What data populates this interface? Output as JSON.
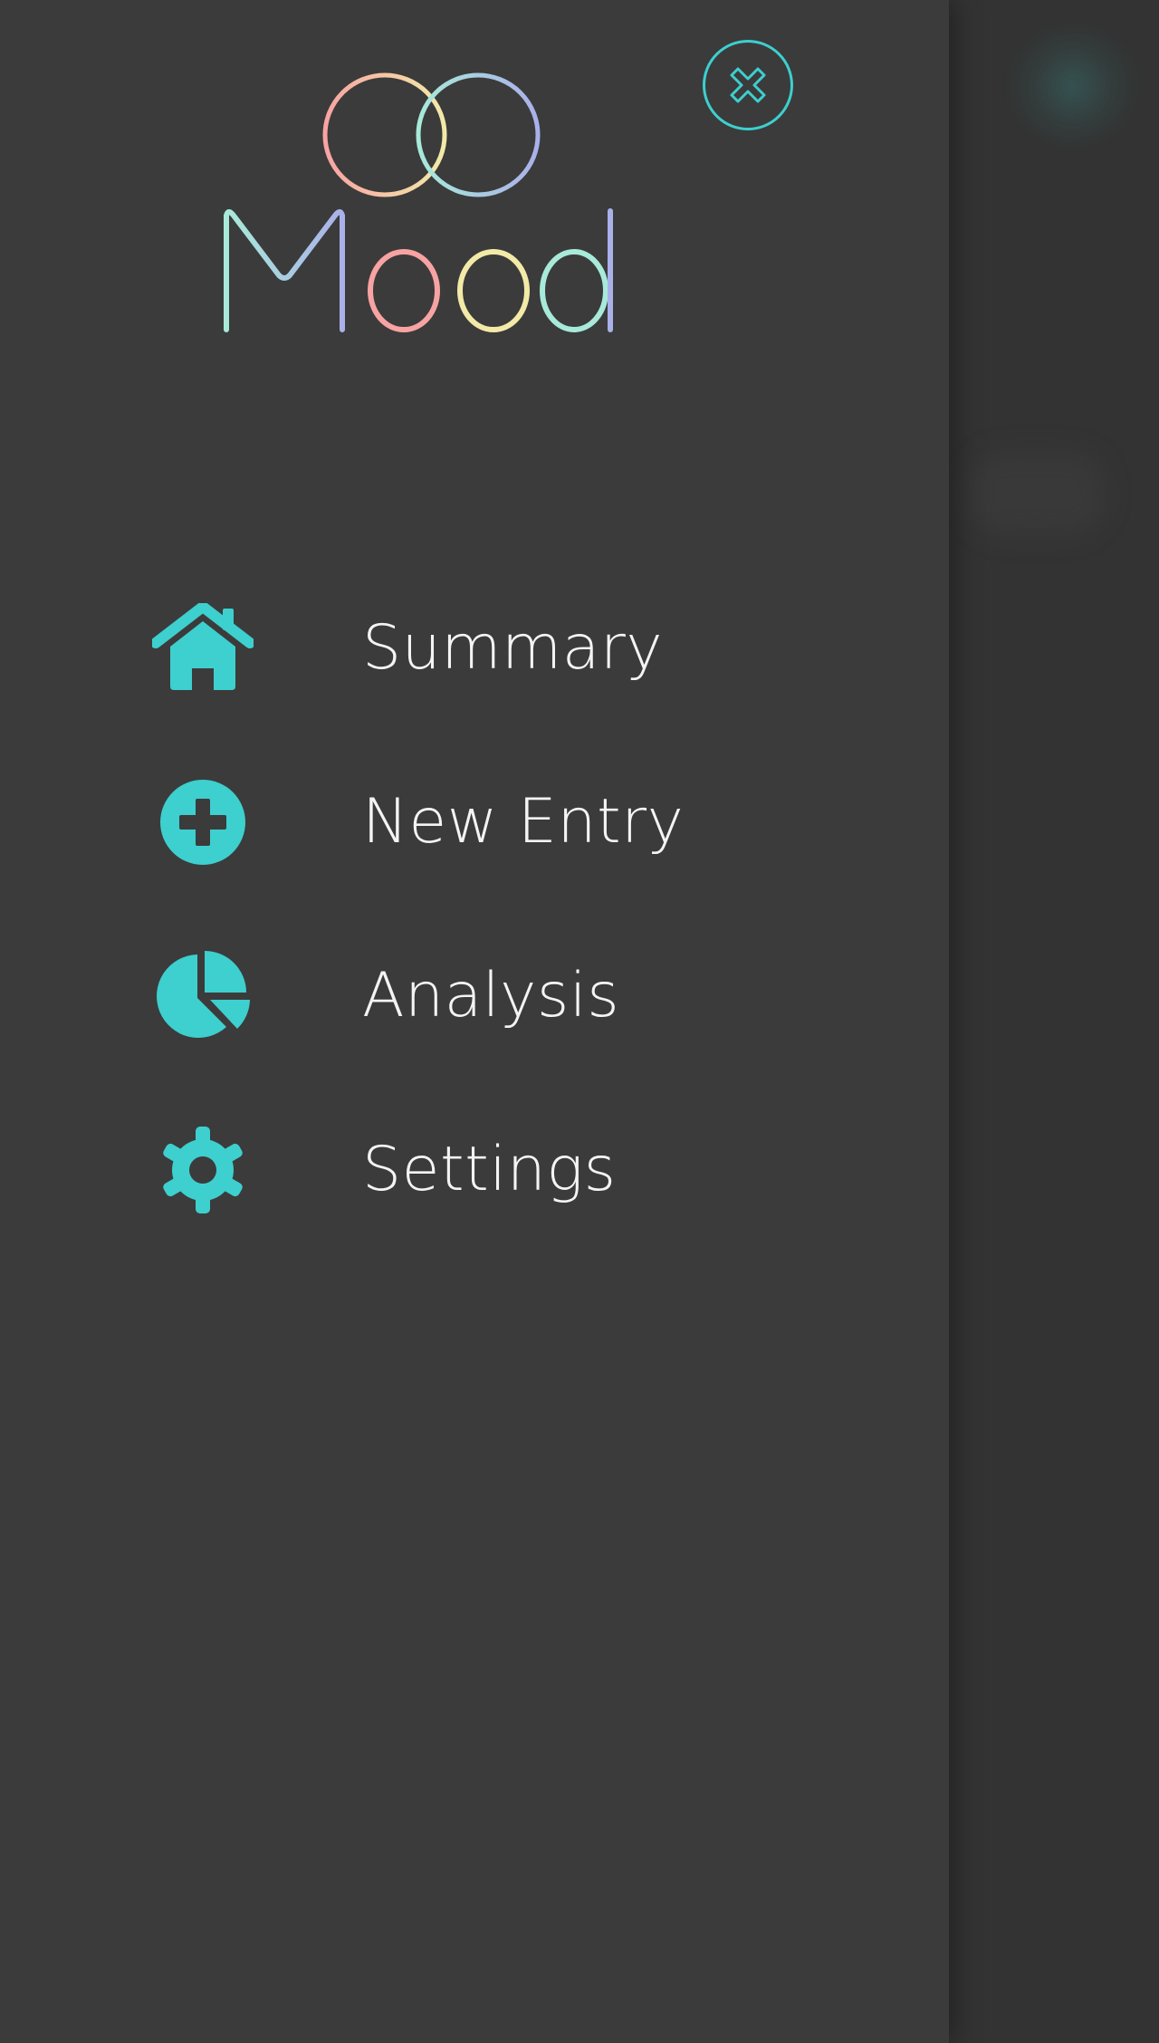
{
  "app": {
    "name": "Mood",
    "accent_color": "#3ecfcf",
    "logo_gradient": [
      "#f8a3a3",
      "#f3eaa8",
      "#a8ead9",
      "#aab0ea"
    ]
  },
  "close": {
    "icon": "close-icon"
  },
  "menu": {
    "items": [
      {
        "label": "Summary",
        "icon": "home-icon"
      },
      {
        "label": "New Entry",
        "icon": "plus-circle-icon"
      },
      {
        "label": "Analysis",
        "icon": "pie-chart-icon"
      },
      {
        "label": "Settings",
        "icon": "gear-icon"
      }
    ]
  }
}
